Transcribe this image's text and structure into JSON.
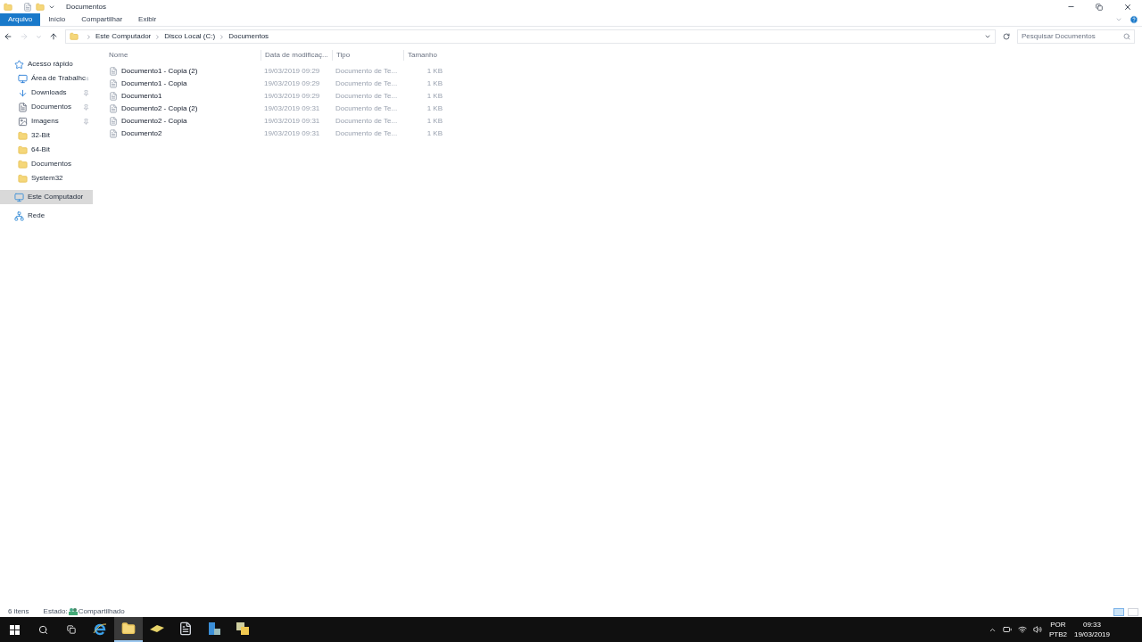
{
  "window": {
    "title": "Documentos"
  },
  "ribbon_tabs": [
    {
      "label": "Arquivo",
      "selected": true
    },
    {
      "label": "Início",
      "selected": false
    },
    {
      "label": "Compartilhar",
      "selected": false
    },
    {
      "label": "Exibir",
      "selected": false
    }
  ],
  "breadcrumb": [
    "Este Computador",
    "Disco Local (C:)",
    "Documentos"
  ],
  "search": {
    "placeholder": "Pesquisar Documentos"
  },
  "sidebar": [
    {
      "label": "Acesso rápido",
      "kind": "star",
      "selected": false,
      "children": [
        {
          "label": "Área de Trabalhc",
          "kind": "desktop",
          "pinned": true,
          "selected": false
        },
        {
          "label": "Downloads",
          "kind": "download",
          "pinned": true,
          "selected": false
        },
        {
          "label": "Documentos",
          "kind": "docs",
          "pinned": true,
          "selected": false
        },
        {
          "label": "Imagens",
          "kind": "images",
          "pinned": true,
          "selected": false
        },
        {
          "label": "32-Bit",
          "kind": "folder",
          "pinned": false,
          "selected": false
        },
        {
          "label": "64-Bit",
          "kind": "folder",
          "pinned": false,
          "selected": false
        },
        {
          "label": "Documentos",
          "kind": "folder",
          "pinned": false,
          "selected": false
        },
        {
          "label": "System32",
          "kind": "folder",
          "pinned": false,
          "selected": false
        }
      ]
    },
    {
      "label": "Este Computador",
      "kind": "pc",
      "selected": true
    },
    {
      "label": "Rede",
      "kind": "network",
      "selected": false
    }
  ],
  "table": {
    "columns": [
      "Nome",
      "Data de modificaç...",
      "Tipo",
      "Tamanho"
    ],
    "rows": [
      [
        "Documento1 - Copia (2)",
        "19/03/2019 09:29",
        "Documento de Te...",
        "1 KB"
      ],
      [
        "Documento1 - Copia",
        "19/03/2019 09:29",
        "Documento de Te...",
        "1 KB"
      ],
      [
        "Documento1",
        "19/03/2019 09:29",
        "Documento de Te...",
        "1 KB"
      ],
      [
        "Documento2 - Copia (2)",
        "19/03/2019 09:31",
        "Documento de Te...",
        "1 KB"
      ],
      [
        "Documento2 - Copia",
        "19/03/2019 09:31",
        "Documento de Te...",
        "1 KB"
      ],
      [
        "Documento2",
        "19/03/2019 09:31",
        "Documento de Te...",
        "1 KB"
      ]
    ]
  },
  "status_bar": {
    "count": "6 itens",
    "state_label": "Estado:",
    "state_value": "Compartilhado"
  },
  "taskbar": {
    "apps": [
      {
        "kind": "ie",
        "selected": false
      },
      {
        "kind": "explorer",
        "selected": true
      },
      {
        "kind": "tool",
        "selected": false
      },
      {
        "kind": "notepad",
        "selected": false
      },
      {
        "kind": "server",
        "selected": false
      },
      {
        "kind": "files",
        "selected": false
      }
    ],
    "lang_top": "POR",
    "lang_bottom": "PTB2",
    "time": "09:33",
    "date": "19/03/2019"
  }
}
